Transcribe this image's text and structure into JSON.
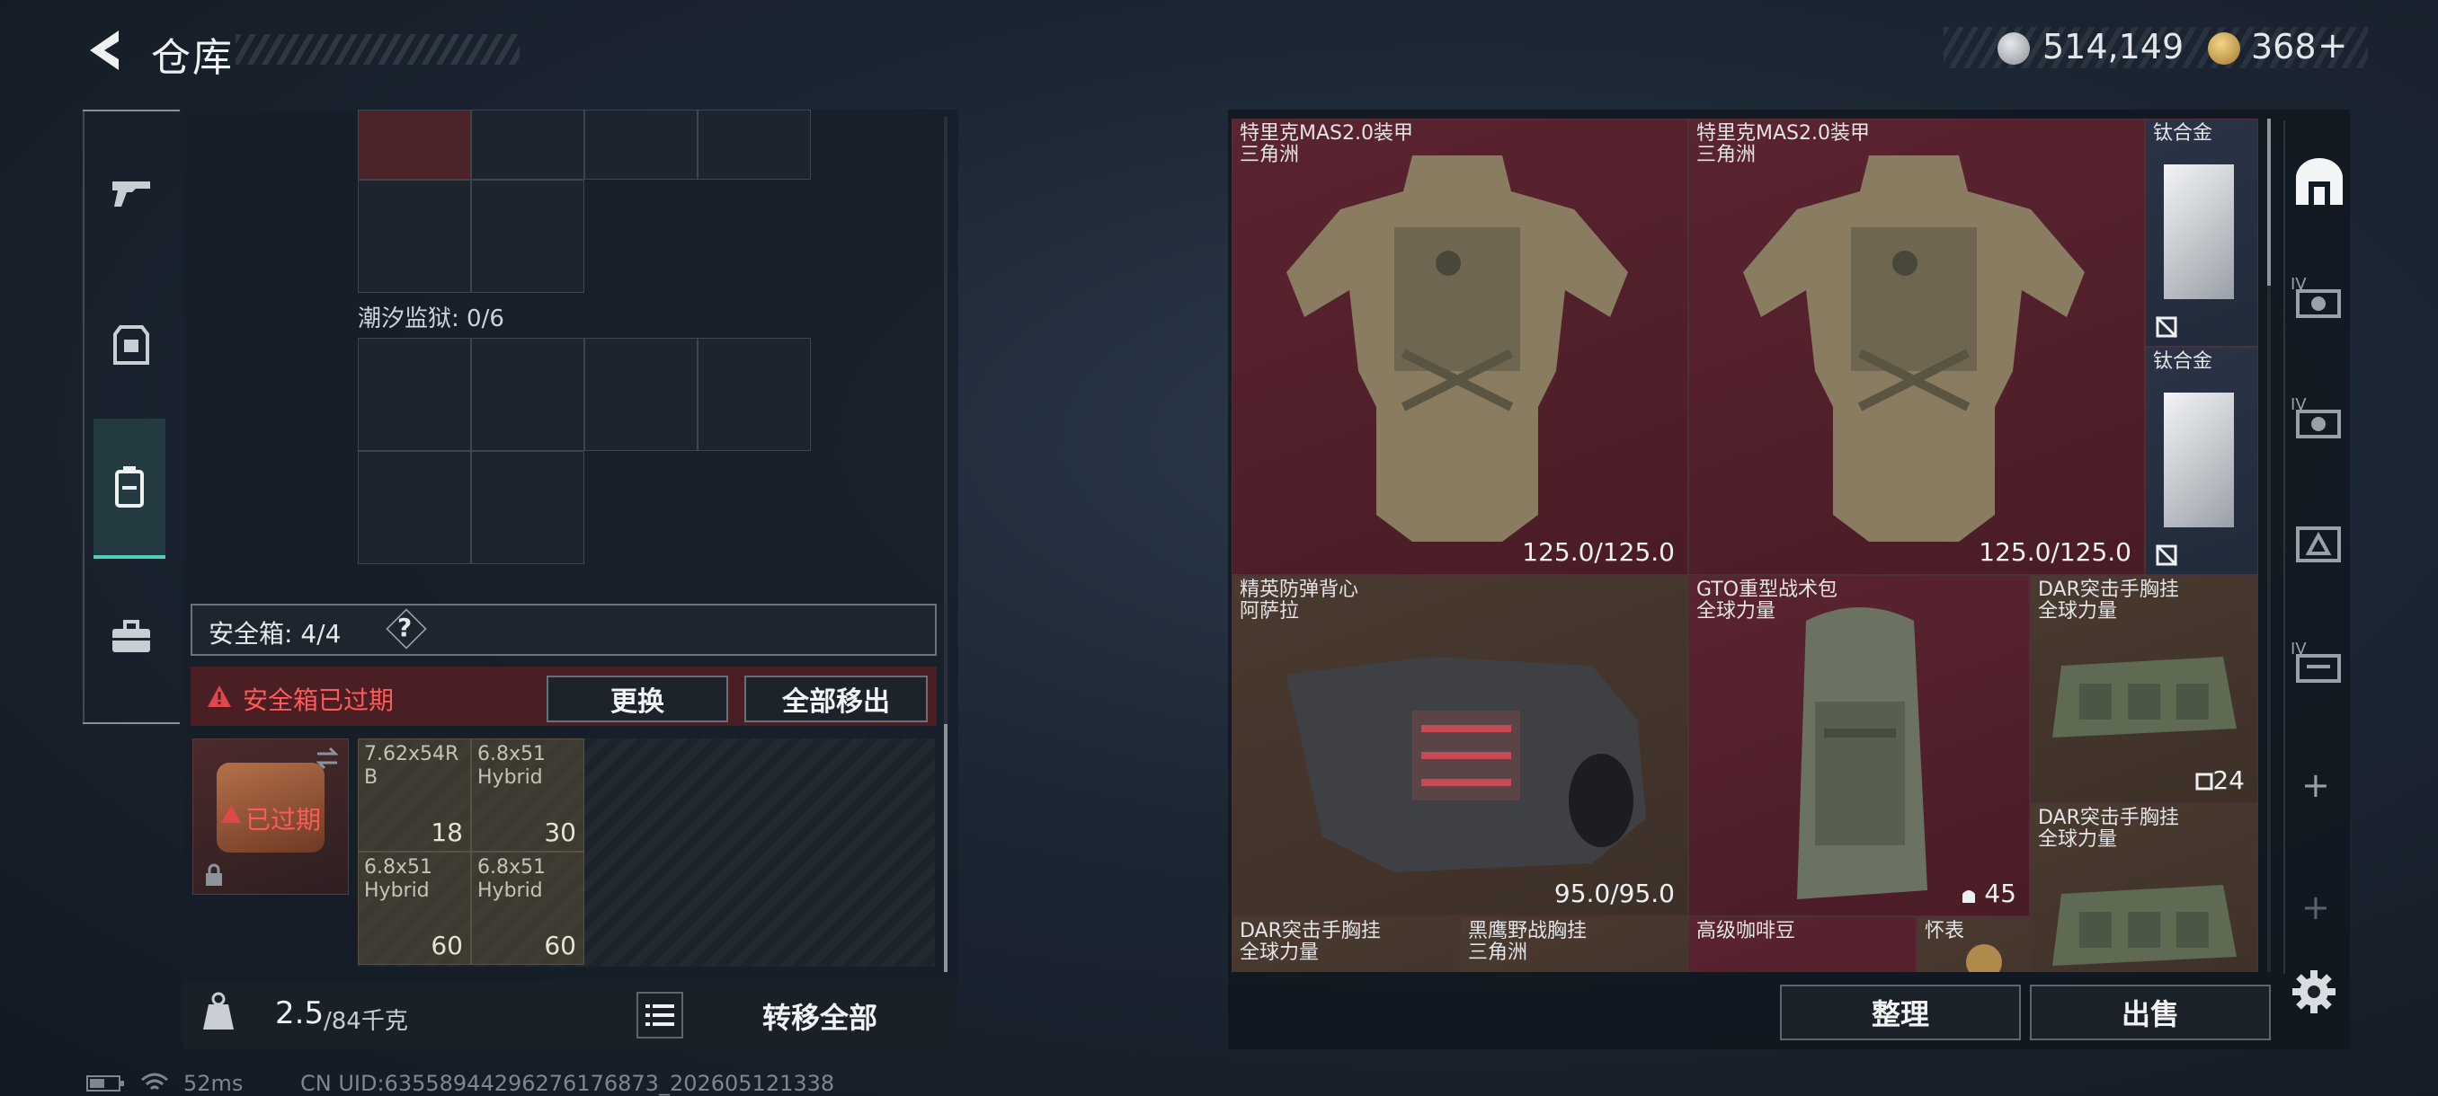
{
  "header": {
    "title": "仓库",
    "silver_amount": "514,149",
    "gold_amount": "368",
    "plus_label": "+"
  },
  "colors": {
    "accent_teal": "#4fd1b9",
    "warning_red": "#e0474a",
    "item_red": "#5a2430",
    "item_brown": "#4a3a30",
    "item_blue": "#2a3446"
  },
  "category_tabs": [
    {
      "icon": "gun-icon"
    },
    {
      "icon": "armor-icon"
    },
    {
      "icon": "backpack-icon",
      "active": true
    },
    {
      "icon": "toolbox-icon"
    }
  ],
  "left": {
    "container_label": "潮汐监狱: 0/6",
    "safe_box_label": "安全箱: 4/4",
    "help_glyph": "?",
    "expired_warning": "安全箱已过期",
    "replace_button": "更换",
    "move_all_out_button": "全部移出",
    "expired_badge": "已过期",
    "ammo": [
      {
        "name": "7.62x54R\nB",
        "count": "18"
      },
      {
        "name": "6.8x51\nHybrid",
        "count": "30"
      },
      {
        "name": "6.8x51\nHybrid",
        "count": "60"
      },
      {
        "name": "6.8x51\nHybrid",
        "count": "60"
      }
    ],
    "weight_current": "2.5",
    "weight_max": "/84千克",
    "transfer_all_button": "转移全部"
  },
  "right": {
    "items": [
      {
        "name": "特里克MAS2.0装甲",
        "sub": "三角洲",
        "value": "125.0/125.0"
      },
      {
        "name": "特里克MAS2.0装甲",
        "sub": "三角洲",
        "value": "125.0/125.0"
      },
      {
        "name": "钛合金",
        "sub": ""
      },
      {
        "name": "钛合金",
        "sub": ""
      },
      {
        "name": "精英防弹背心",
        "sub": "阿萨拉",
        "value": "95.0/95.0"
      },
      {
        "name": "GTO重型战术包",
        "sub": "全球力量",
        "value": "45"
      },
      {
        "name": "DAR突击手胸挂",
        "sub": "全球力量",
        "value": "24"
      },
      {
        "name": "DAR突击手胸挂",
        "sub": "全球力量"
      },
      {
        "name": "DAR突击手胸挂",
        "sub": "全球力量"
      },
      {
        "name": "黑鹰野战胸挂",
        "sub": "三角洲"
      },
      {
        "name": "高级咖啡豆",
        "sub": ""
      },
      {
        "name": "怀表",
        "sub": ""
      }
    ],
    "sort_button": "整理",
    "sell_button": "出售",
    "side_tabs": [
      {
        "icon": "home-storage-icon",
        "tier": ""
      },
      {
        "icon": "storage-tier-icon",
        "tier": "IV"
      },
      {
        "icon": "storage-tier-icon",
        "tier": "IV"
      },
      {
        "icon": "storage-tier-icon",
        "tier": ""
      },
      {
        "icon": "storage-tier-icon",
        "tier": "IV"
      }
    ],
    "add_glyph": "+",
    "settings_icon": "gear-icon"
  },
  "status": {
    "ping": "52ms",
    "uid": "CN UID:63558944296276176873_202605121338"
  }
}
